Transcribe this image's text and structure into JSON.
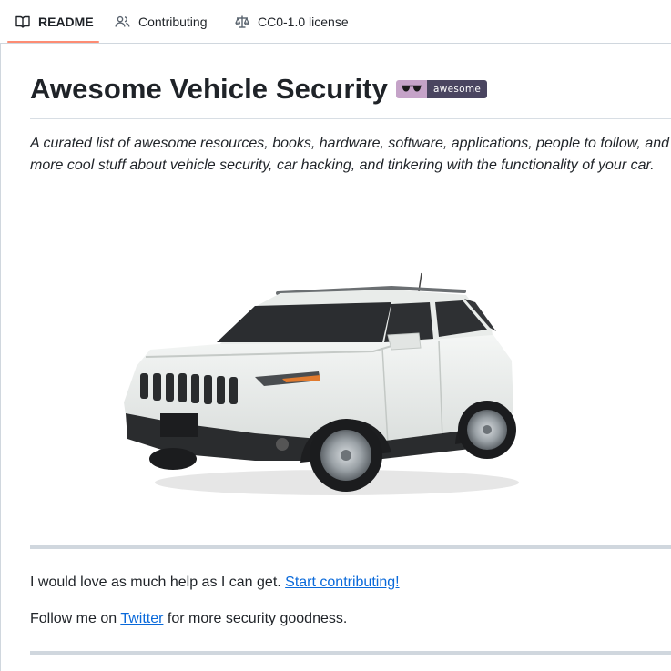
{
  "tabs": [
    {
      "label": "README",
      "icon": "book-icon",
      "active": true
    },
    {
      "label": "Contributing",
      "icon": "people-icon",
      "active": false
    },
    {
      "label": "CC0-1.0 license",
      "icon": "law-scale-icon",
      "active": false
    }
  ],
  "readme": {
    "title": "Awesome Vehicle Security",
    "badge": {
      "icon": "sunglasses-icon",
      "text": "awesome"
    },
    "intro": "A curated list of awesome resources, books, hardware, software, applications, people to follow, and more cool stuff about vehicle security, car hacking, and tinkering with the functionality of your car.",
    "image": "car-image",
    "help": {
      "text": "I would love as much help as I can get. ",
      "link": "Start contributing!"
    },
    "follow": {
      "before": "Follow me on ",
      "link": "Twitter",
      "after": " for more security goodness."
    }
  },
  "colors": {
    "accent_underline": "#fd8c73",
    "link": "#0969da",
    "badge_left": "#c5a3c8",
    "badge_right": "#4a4560"
  }
}
